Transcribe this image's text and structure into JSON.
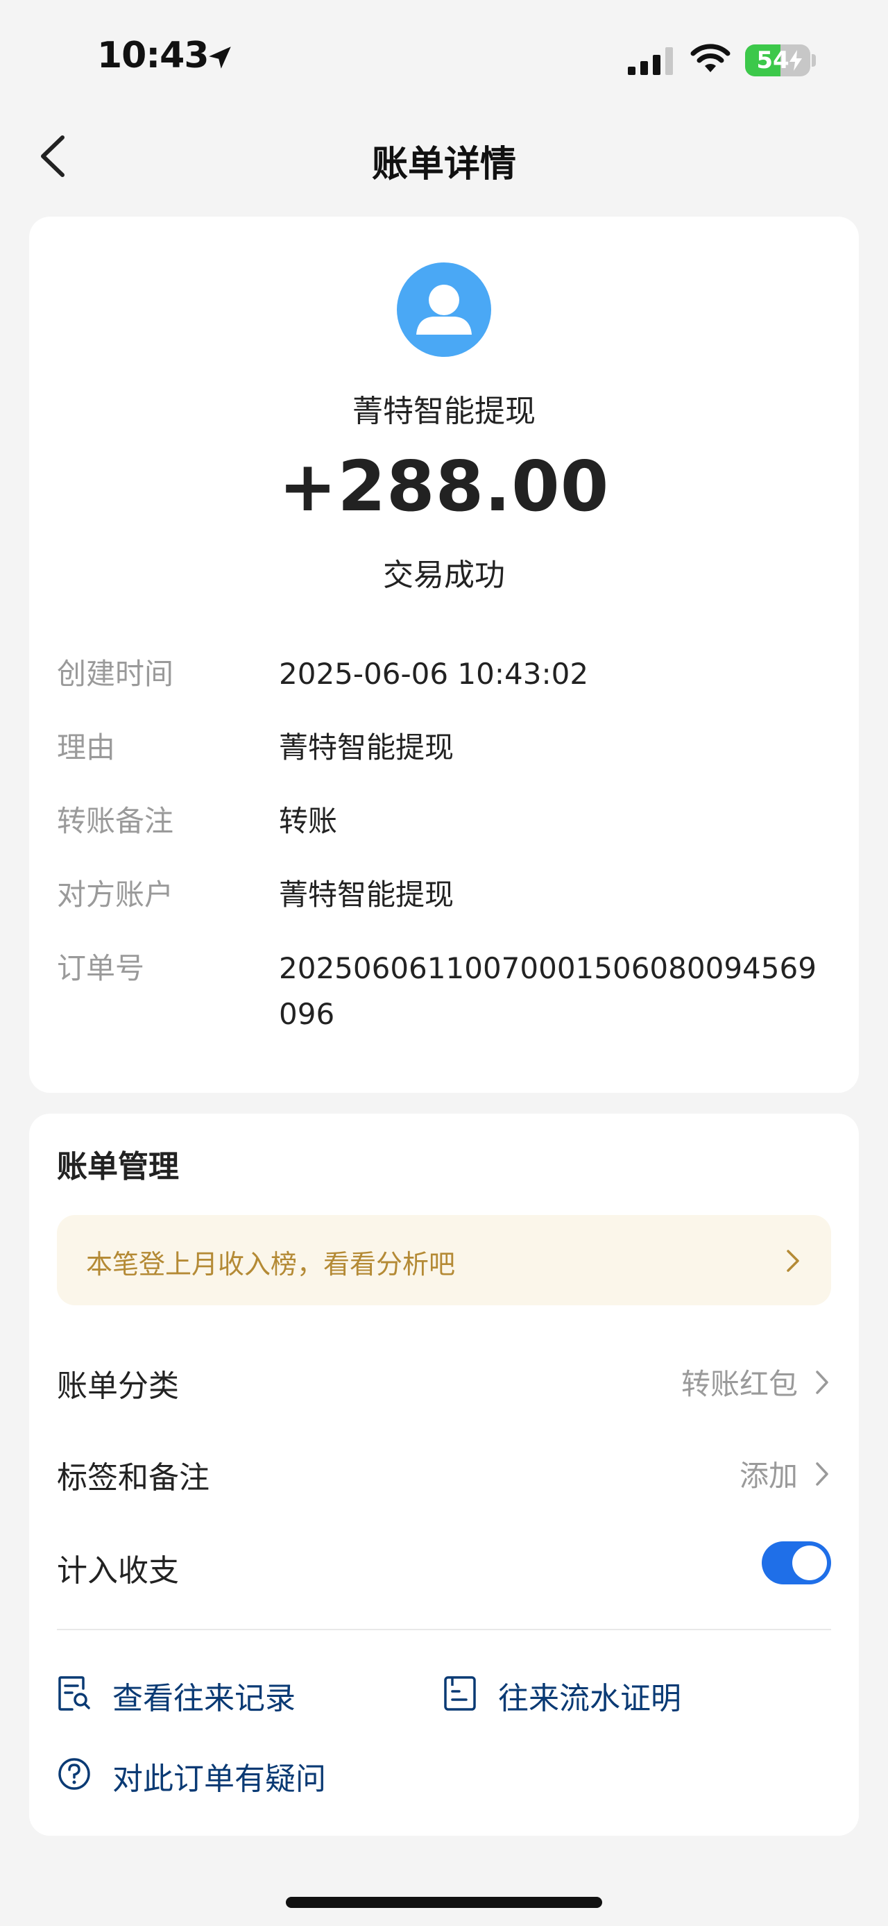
{
  "status_bar": {
    "time": "10:43",
    "battery": "54",
    "battery_level": 0.54
  },
  "nav": {
    "title": "账单详情"
  },
  "transaction": {
    "payee": "菁特智能提现",
    "amount": "+288.00",
    "status": "交易成功"
  },
  "details": [
    {
      "label": "创建时间",
      "value": "2025-06-06 10:43:02"
    },
    {
      "label": "理由",
      "value": "菁特智能提现"
    },
    {
      "label": "转账备注",
      "value": "转账"
    },
    {
      "label": "对方账户",
      "value": "菁特智能提现"
    },
    {
      "label": "订单号",
      "value": "20250606110070001506080094569096"
    }
  ],
  "management": {
    "title": "账单管理",
    "promo": "本笔登上月收入榜，看看分析吧",
    "category_label": "账单分类",
    "category_value": "转账红包",
    "tags_label": "标签和备注",
    "tags_value": "添加",
    "include_label": "计入收支",
    "include_enabled": true
  },
  "links": {
    "history": "查看往来记录",
    "statement": "往来流水证明",
    "question": "对此订单有疑问"
  },
  "colors": {
    "accent_blue": "#1f6fe8",
    "link_text": "#0a3a74",
    "promo_text": "#b48a35",
    "avatar_bg": "#4aa8f5",
    "battery_green": "#3cc84a"
  }
}
